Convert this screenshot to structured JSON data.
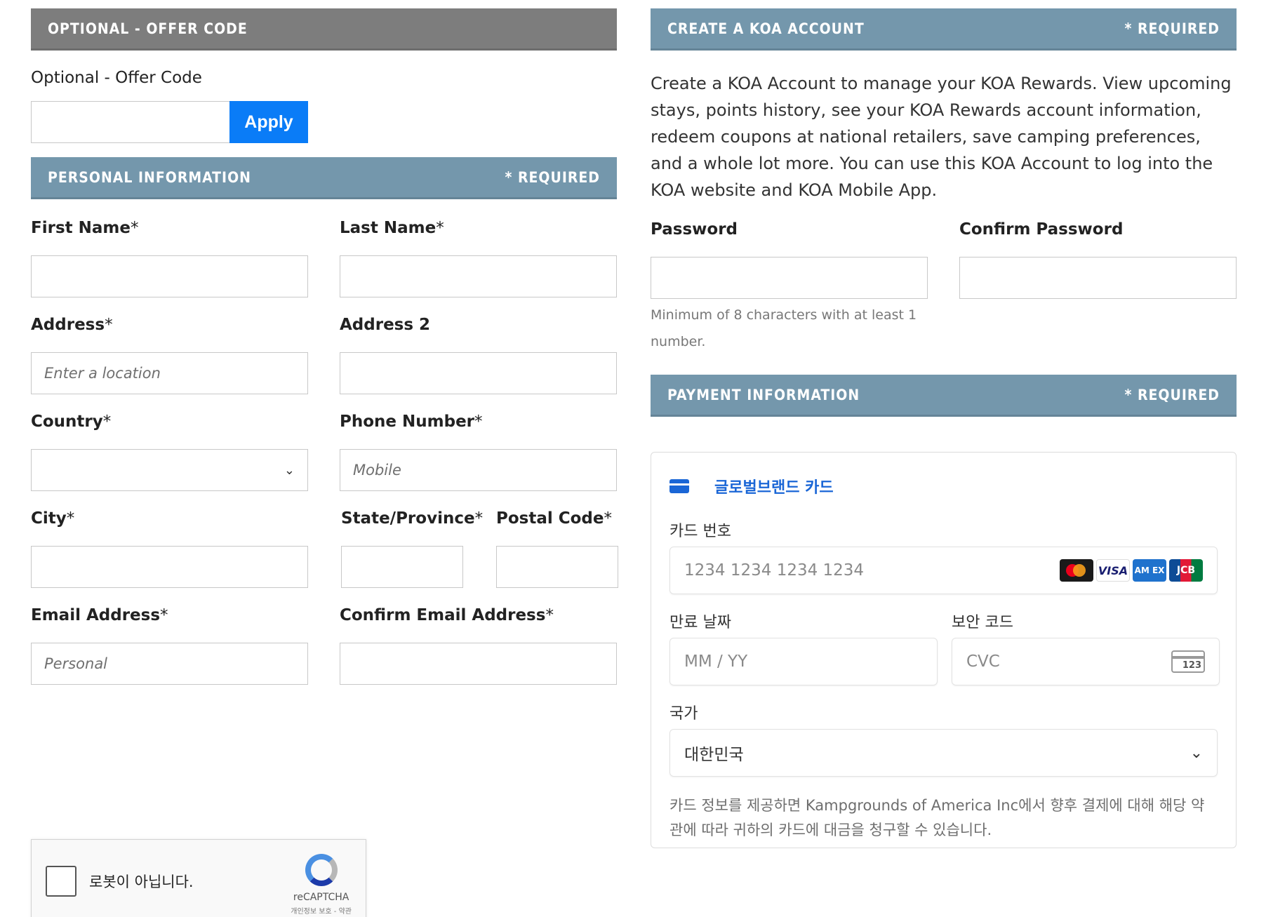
{
  "offer": {
    "header": "OPTIONAL - OFFER CODE",
    "label": "Optional - Offer Code",
    "apply_label": "Apply"
  },
  "personal": {
    "header": "PERSONAL INFORMATION",
    "required": "* REQUIRED",
    "first_name": "First Name",
    "last_name": "Last Name",
    "address": "Address",
    "address_placeholder": "Enter a location",
    "address2": "Address 2",
    "country": "Country",
    "phone": "Phone Number",
    "phone_placeholder": "Mobile",
    "city": "City",
    "state": "State/Province",
    "postal": "Postal Code",
    "email": "Email Address",
    "email_placeholder": "Personal",
    "confirm_email": "Confirm Email Address",
    "asterisk": "*"
  },
  "account": {
    "header": "CREATE A KOA ACCOUNT",
    "required": "* REQUIRED",
    "description": "Create a KOA Account to manage your KOA Rewards. View upcoming stays, points history, see your KOA Rewards account information, redeem coupons at national retailers, save camping preferences, and a whole lot more. You can use this KOA Account to log into the KOA website and KOA Mobile App.",
    "password": "Password",
    "confirm_password": "Confirm Password",
    "password_hint": "Minimum of 8 characters with at least 1 number."
  },
  "payment": {
    "header": "PAYMENT INFORMATION",
    "required": "* REQUIRED",
    "tab_label": "글로벌브랜드 카드",
    "card_number_label": "카드 번호",
    "card_number_placeholder": "1234 1234 1234 1234",
    "brands": [
      "VISA",
      "AM EX",
      "JCB"
    ],
    "expiry_label": "만료 날짜",
    "expiry_placeholder": "MM / YY",
    "cvc_label": "보안 코드",
    "cvc_placeholder": "CVC",
    "cvc_icon_text": "123",
    "country_label": "국가",
    "country_value": "대한민국",
    "note": "카드 정보를 제공하면 Kampgrounds of America Inc에서 향후 결제에 대해 해당 약관에 따라 귀하의 카드에 대금을 청구할 수 있습니다."
  },
  "recaptcha": {
    "label": "로봇이 아닙니다.",
    "brand": "reCAPTCHA",
    "terms": "개인정보 보호 - 약관"
  },
  "colors": {
    "band_blue": "#7497ac",
    "band_gray": "#7d7d7d",
    "apply_blue": "#0a7cf7",
    "stripe_blue": "#1a66d6"
  }
}
